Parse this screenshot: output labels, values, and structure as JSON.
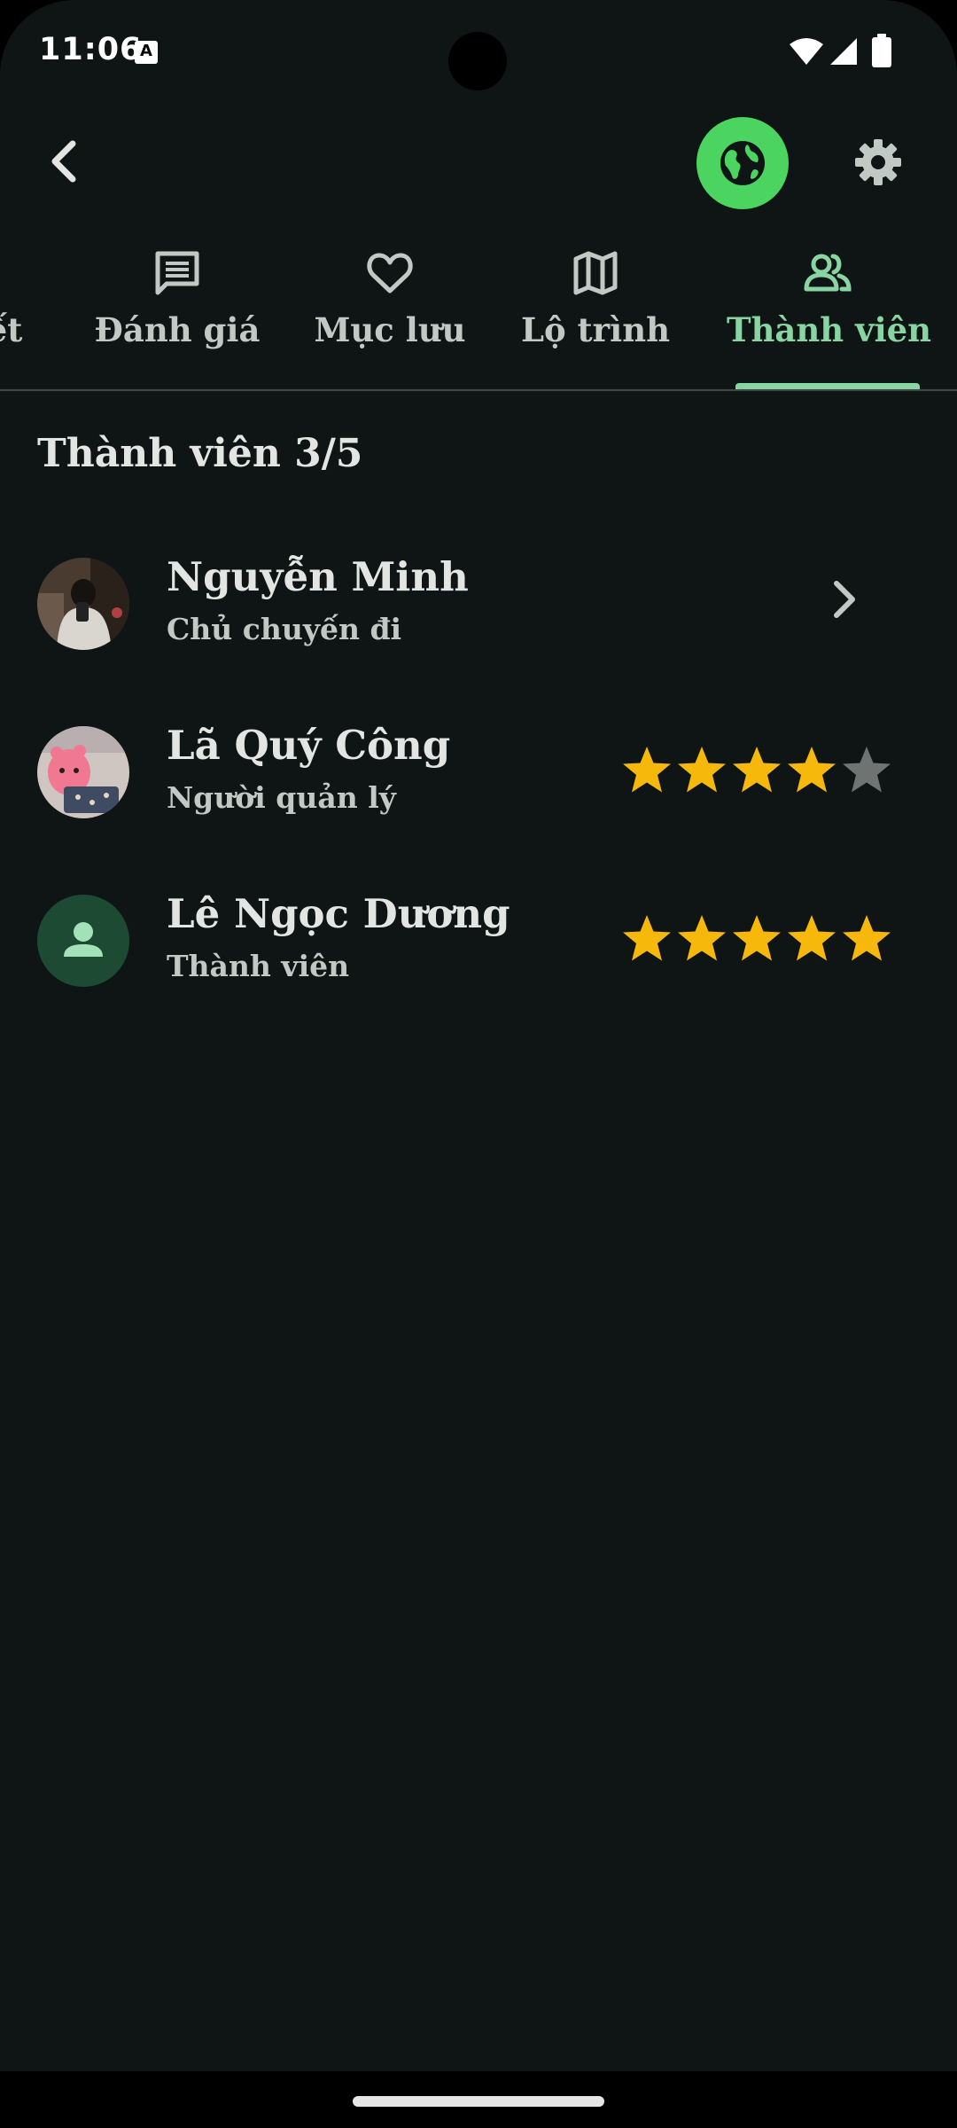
{
  "status_bar": {
    "time": "11:06",
    "notification_icon_letter": "A"
  },
  "app_bar": {
    "back_icon": "arrow-back-icon",
    "globe_icon": "globe-icon",
    "settings_icon": "gear-icon",
    "colors": {
      "globe_button": "#4cd460"
    }
  },
  "tabs": [
    {
      "label": "ết",
      "icon": "info-icon"
    },
    {
      "label": "Đánh giá",
      "icon": "chat-icon"
    },
    {
      "label": "Mục lưu",
      "icon": "heart-icon"
    },
    {
      "label": "Lộ trình",
      "icon": "map-icon"
    },
    {
      "label": "Thành viên",
      "icon": "group-icon",
      "active": true
    }
  ],
  "members_section": {
    "title": "Thành viên 3/5",
    "members": [
      {
        "name": "Nguyễn Minh",
        "role": "Chủ chuyến đi",
        "avatar": "photo",
        "trailing": "chevron-right-icon"
      },
      {
        "name": "Lã Quý Công",
        "role": "Người quản lý",
        "avatar": "photo",
        "rating": 4,
        "rating_max": 5
      },
      {
        "name": "Lê Ngọc Dương",
        "role": "Thành viên",
        "avatar": "person-icon",
        "rating": 5,
        "rating_max": 5
      }
    ]
  },
  "colors": {
    "background": "#0f1514",
    "accent": "#89d4a3",
    "star_filled": "#f5b80b",
    "star_empty": "#6f7371",
    "text_primary": "#e3e5e2",
    "text_secondary": "#c1c9c5"
  }
}
